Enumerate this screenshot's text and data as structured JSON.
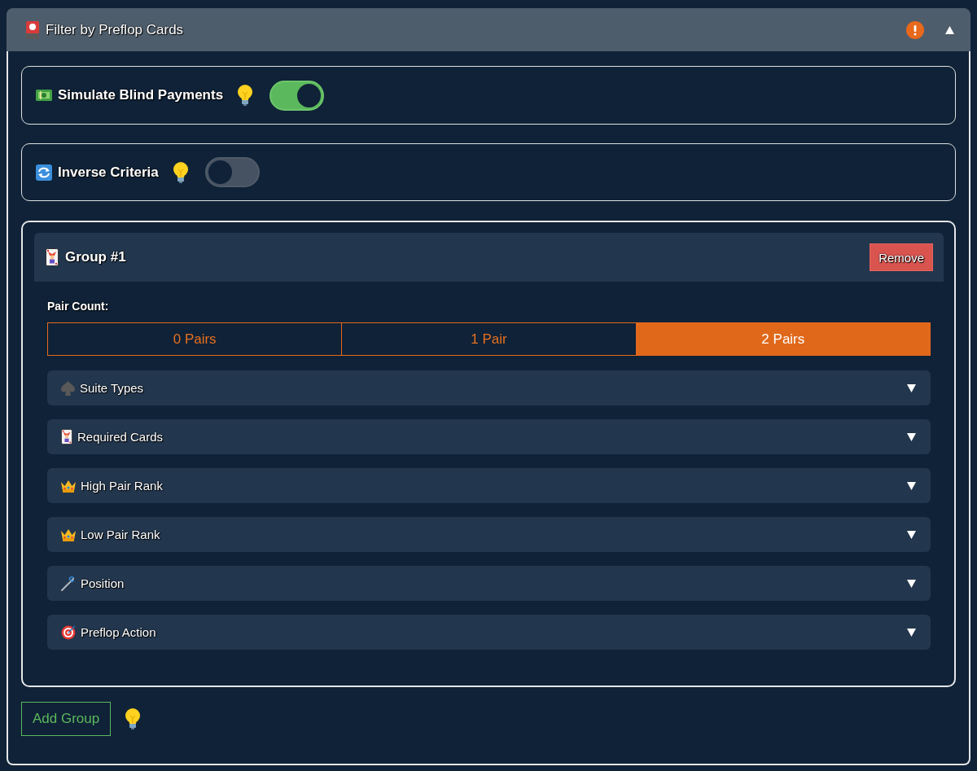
{
  "panel": {
    "title": "Filter by Preflop Cards",
    "expanded": true
  },
  "toggles": [
    {
      "label": "Simulate Blind Payments",
      "on": true
    },
    {
      "label": "Inverse Criteria",
      "on": false
    }
  ],
  "group": {
    "title": "Group #1",
    "remove_button": "Remove",
    "pair_count": {
      "label": "Pair Count:",
      "options": [
        {
          "label": "0 Pairs",
          "selected": false
        },
        {
          "label": "1 Pair",
          "selected": false
        },
        {
          "label": "2 Pairs",
          "selected": true
        }
      ]
    },
    "sections": [
      {
        "label": "Suite Types",
        "expanded": false
      },
      {
        "label": "Required Cards",
        "expanded": false
      },
      {
        "label": "High Pair Rank",
        "expanded": false
      },
      {
        "label": "Low Pair Rank",
        "expanded": false
      },
      {
        "label": "Position",
        "expanded": false
      },
      {
        "label": "Preflop Action",
        "expanded": false
      }
    ]
  },
  "add_group_button": "Add Group"
}
